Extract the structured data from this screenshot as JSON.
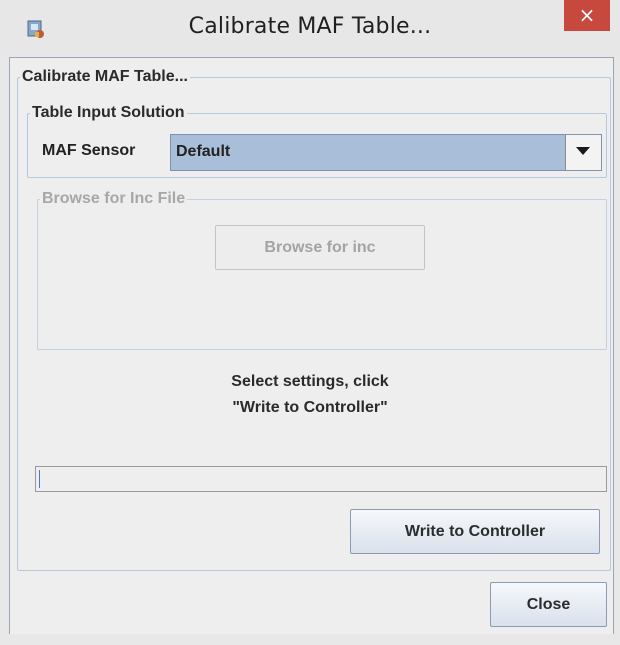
{
  "window": {
    "title": "Calibrate MAF Table...",
    "close_glyph": "×",
    "app_icon": "java-app-icon"
  },
  "main_group": {
    "legend": "Calibrate MAF Table..."
  },
  "input_group": {
    "legend": "Table Input Solution",
    "maf_label": "MAF Sensor",
    "maf_value": "Default"
  },
  "browse_group": {
    "legend": "Browse for Inc File",
    "button_label": "Browse for inc",
    "enabled": false
  },
  "message": {
    "line1": "Select settings, click",
    "line2": "\"Write to Controller\""
  },
  "progress": {
    "value": 0
  },
  "buttons": {
    "write_label": "Write to Controller",
    "close_label": "Close"
  },
  "colors": {
    "close_button": "#c7483c",
    "combo_selected": "#a9bed9",
    "group_border": "#b8c8dc"
  }
}
